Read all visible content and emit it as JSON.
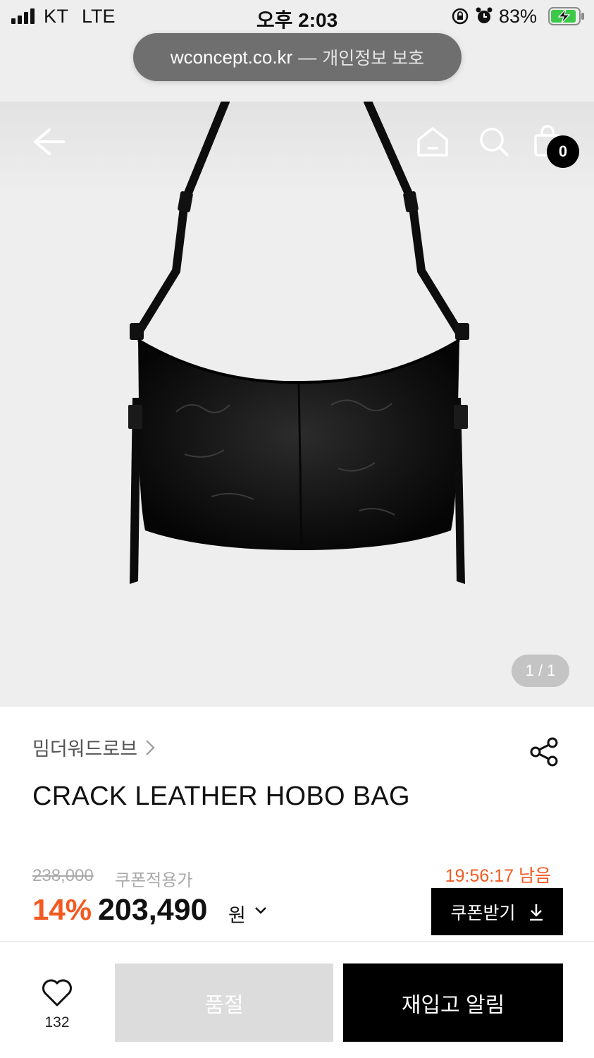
{
  "status_bar": {
    "carrier": "KT",
    "network": "LTE",
    "time": "오후 2:03",
    "battery_percent": "83%"
  },
  "url_bar": {
    "domain": "wconcept.co.kr",
    "separator": "—",
    "privacy_label": "개인정보 보호"
  },
  "header": {
    "cart_count": "0",
    "icons": [
      "back-arrow-icon",
      "home-icon",
      "search-icon",
      "shopping-bag-icon"
    ]
  },
  "gallery": {
    "counter": "1 / 1"
  },
  "product": {
    "brand": "밈더워드로브",
    "title": "CRACK LEATHER HOBO BAG",
    "original_price": "238,000",
    "coupon_applied_label": "쿠폰적용가",
    "discount_percent": "14%",
    "sale_price": "203,490",
    "currency": "원",
    "timer": "19:56:17 남음",
    "coupon_button": "쿠폰받기"
  },
  "bottom_bar": {
    "like_count": "132",
    "soldout_label": "품절",
    "restock_label": "재입고 알림"
  },
  "colors": {
    "accent_orange": "#f25a22",
    "background_gray": "#eeeeee",
    "button_black": "#000000",
    "soldout_gray": "#dcdcdc"
  }
}
